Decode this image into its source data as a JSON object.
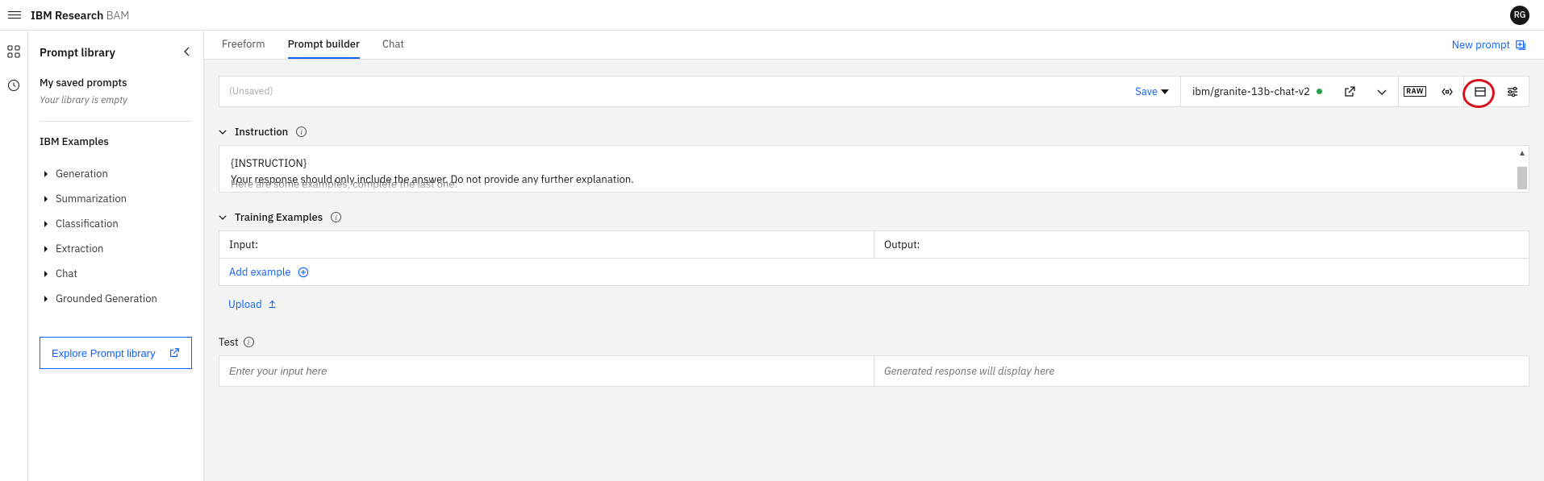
{
  "header": {
    "brand_bold": "IBM Research",
    "brand_thin": " BAM",
    "avatar_initials": "RG"
  },
  "sidebar": {
    "title": "Prompt library",
    "saved_title": "My saved prompts",
    "empty_text": "Your library is empty",
    "examples_title": "IBM Examples",
    "examples": [
      "Generation",
      "Summarization",
      "Classification",
      "Extraction",
      "Chat",
      "Grounded Generation"
    ],
    "explore_label": "Explore Prompt library"
  },
  "tabs": {
    "items": [
      "Freeform",
      "Prompt builder",
      "Chat"
    ],
    "new_prompt_label": "New prompt"
  },
  "toolbar": {
    "unsaved_label": "(Unsaved)",
    "save_label": "Save",
    "model_name": "ibm/granite-13b-chat-v2",
    "raw_label": "RAW"
  },
  "instruction": {
    "title": "Instruction",
    "line1": "{INSTRUCTION}",
    "line2": "Your response should only include the answer. Do not provide any further explanation.",
    "cut_preview": "Here are some examples, complete the last one:"
  },
  "training": {
    "title": "Training Examples",
    "input_header": "Input:",
    "output_header": "Output:",
    "add_label": "Add example",
    "upload_label": "Upload"
  },
  "test": {
    "title": "Test",
    "input_placeholder": "Enter your input here",
    "output_placeholder": "Generated response will display here"
  }
}
